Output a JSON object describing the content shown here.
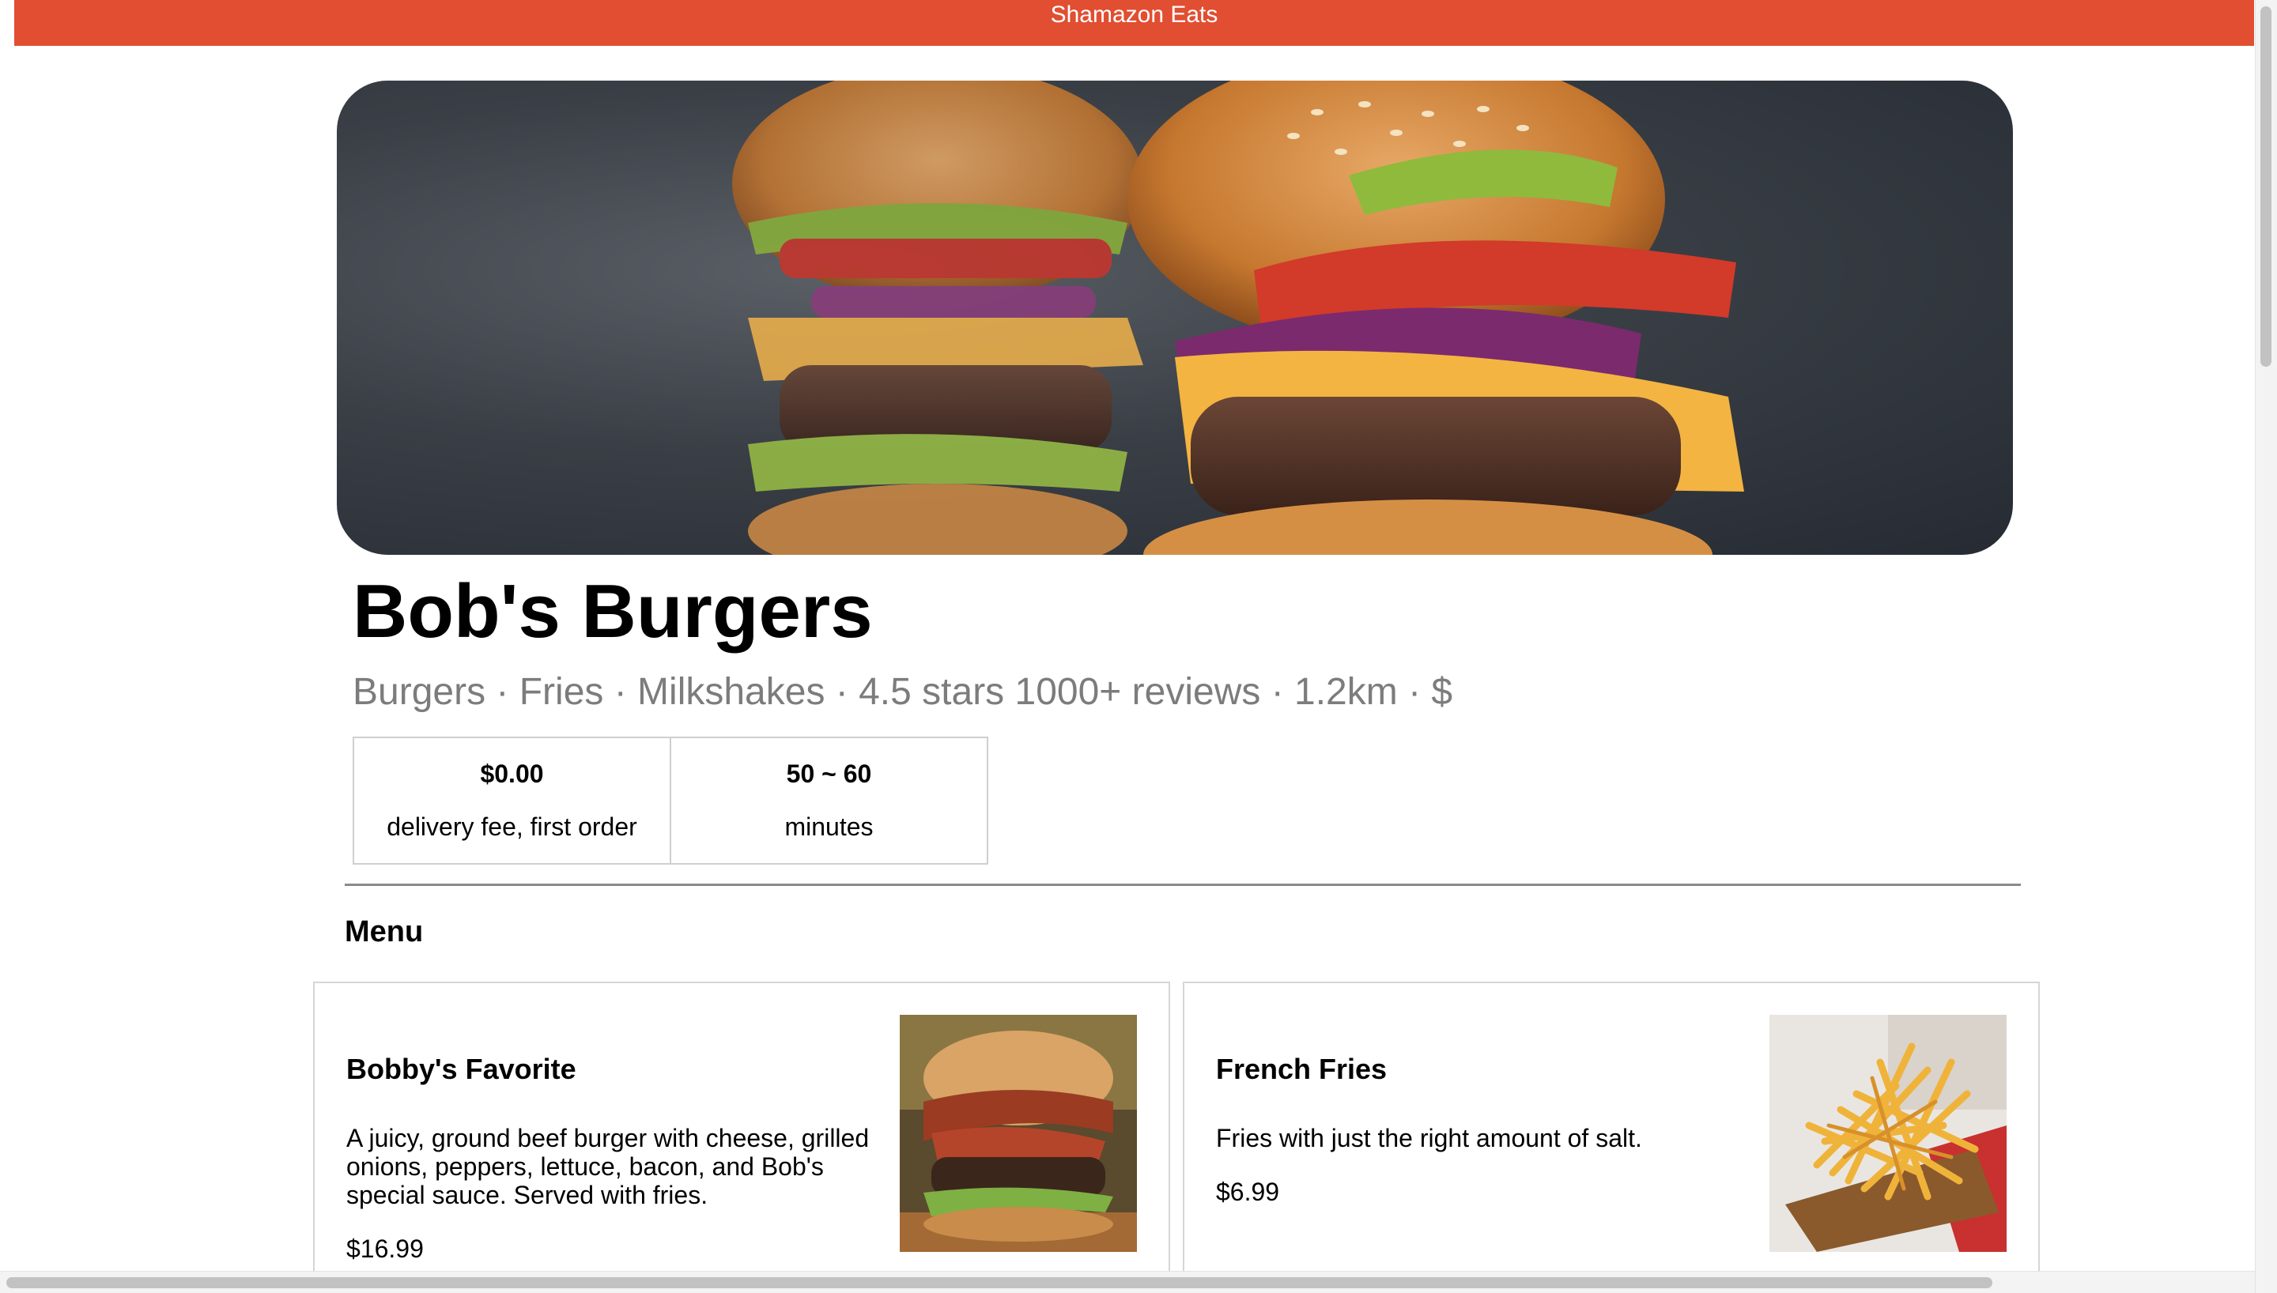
{
  "header": {
    "brand": "Shamazon Eats",
    "brand_color": "#e14e31"
  },
  "restaurant": {
    "name": "Bob's Burgers",
    "subtitle": "Burgers · Fries · Milkshakes · 4.5 stars 1000+ reviews · 1.2km · $",
    "hero_image": "burger-photo",
    "delivery_fee": {
      "value": "$0.00",
      "label": "delivery fee, first order"
    },
    "delivery_time": {
      "value": "50 ~ 60",
      "label": "minutes"
    }
  },
  "menu": {
    "heading": "Menu",
    "items": [
      {
        "name": "Bobby's Favorite",
        "description": "A juicy, ground beef burger with cheese, grilled onions, peppers, lettuce, bacon, and Bob's special sauce. Served with fries.",
        "price": "$16.99",
        "image": "bacon-burger-photo"
      },
      {
        "name": "French Fries",
        "description": "Fries with just the right amount of salt.",
        "price": "$6.99",
        "image": "french-fries-photo"
      }
    ]
  }
}
